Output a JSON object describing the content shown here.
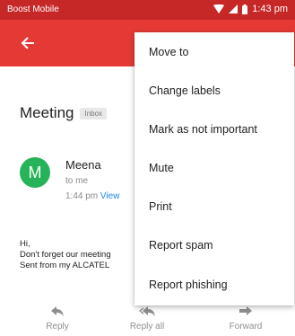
{
  "status_bar": {
    "carrier": "Boost Mobile",
    "time": "1:43 pm"
  },
  "email": {
    "subject": "Meeting",
    "label": "Inbox",
    "sender_initial": "M",
    "sender": "Meena",
    "recipient": "to me",
    "time": "1:44 pm",
    "view_link": "View",
    "body_lines": [
      "Hi,",
      "Don't forget our meeting",
      "Sent from my ALCATEL"
    ]
  },
  "actions": [
    {
      "label": "Reply",
      "icon": "reply-icon"
    },
    {
      "label": "Reply all",
      "icon": "reply-all-icon"
    },
    {
      "label": "Forward",
      "icon": "forward-icon"
    }
  ],
  "menu": {
    "items": [
      {
        "label": "Move to"
      },
      {
        "label": "Change labels"
      },
      {
        "label": "Mark as not important"
      },
      {
        "label": "Mute"
      },
      {
        "label": "Print"
      },
      {
        "label": "Report spam"
      },
      {
        "label": "Report phishing"
      }
    ]
  },
  "colors": {
    "status_bar": "#c62828",
    "app_bar": "#e53935",
    "avatar": "#26b35a",
    "link": "#1e88e5"
  }
}
